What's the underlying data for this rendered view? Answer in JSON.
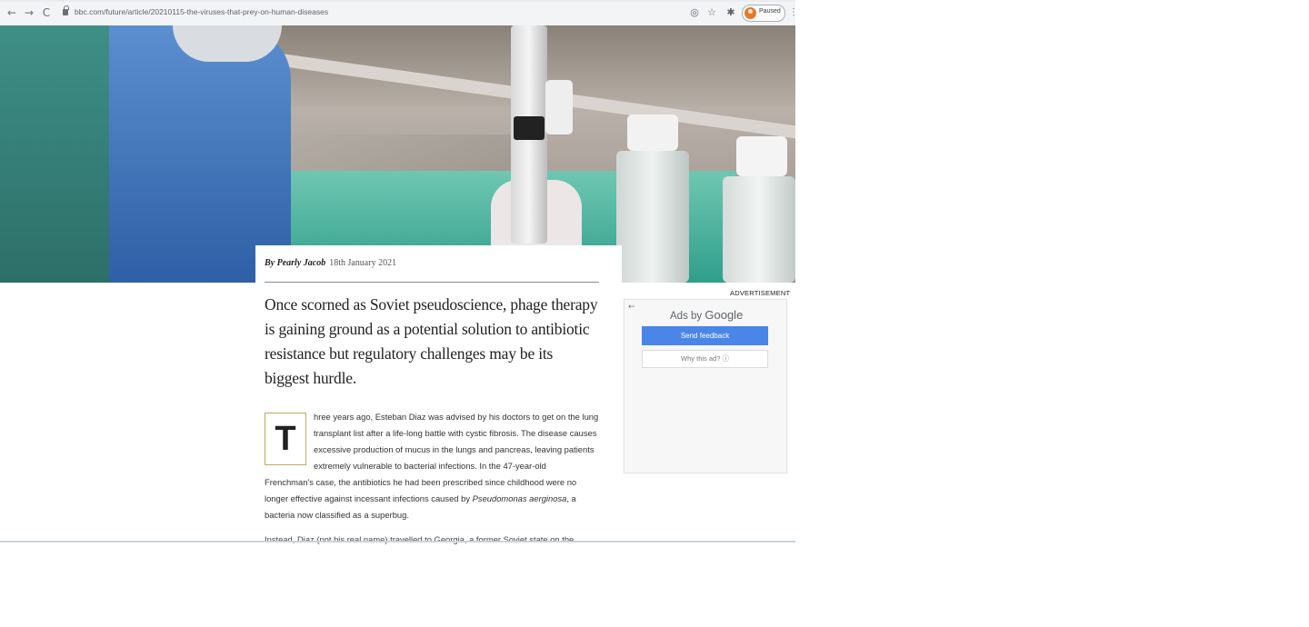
{
  "browser": {
    "nav_back": "←",
    "nav_forward": "→",
    "nav_reload": "C",
    "url": "bbc.com/future/article/20210115-the-viruses-that-prey-on-human-diseases",
    "profile_status": "Paused",
    "icons": [
      "lens-icon",
      "star-icon",
      "extensions-icon",
      "menu-icon"
    ]
  },
  "article": {
    "author": "By Pearly Jacob",
    "date": "18th January 2021",
    "standfirst": "Once scorned as Soviet pseudoscience, phage therapy is gaining ground as a potential solution to antibiotic resistance but regulatory challenges may be its biggest hurdle.",
    "dropcap": "T",
    "para1_lead": "hree years ago, Esteban Diaz was advised by his doctors to get on the lung transplant list after a life-long battle with cystic fibrosis. The disease causes excessive production of mucus in the lungs and pancreas, leaving patients extremely vulnerable to bacterial infections. In the 47-year-old",
    "para1_rest_a": "Frenchman's case, the antibiotics he had been prescribed since childhood were no longer effective against incessant infections caused by",
    "para1_species": "Pseudomonas aerginosa",
    "para1_rest_b": ", a bacteria now classified as a superbug.",
    "para2": "Instead, Diaz (not his real name) travelled to Georgia, a former Soviet state on the"
  },
  "ad": {
    "label": "ADVERTISEMENT",
    "ads_by": "Ads by",
    "google": "Google",
    "send_feedback": "Send feedback",
    "why_this_ad": "Why this ad? ⓘ",
    "back_arrow": "←"
  },
  "colors": {
    "feedback_button": "#4a86e8",
    "dropcap_border": "#c0a866",
    "profile_avatar": "#e37b2b"
  }
}
